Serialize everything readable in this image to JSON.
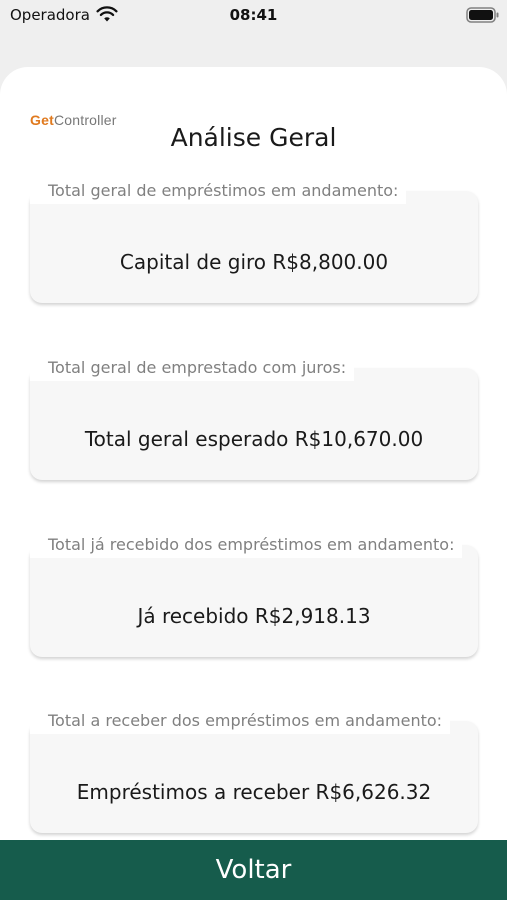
{
  "status_bar": {
    "carrier": "Operadora",
    "time": "08:41",
    "icons": [
      "wifi-icon",
      "battery-icon"
    ]
  },
  "brand": {
    "part1": "Get",
    "part2": "Controller",
    "accent_color": "#e07a1f"
  },
  "page": {
    "title": "Análise Geral"
  },
  "sections": [
    {
      "label": "Total geral de empréstimos em andamento:",
      "value": "Capital de giro R$8,800.00"
    },
    {
      "label": "Total geral de emprestado com juros:",
      "value": "Total geral esperado R$10,670.00"
    },
    {
      "label": "Total já recebido dos empréstimos em andamento:",
      "value": "Já recebido R$2,918.13"
    },
    {
      "label": "Total a receber dos empréstimos em andamento:",
      "value": "Empréstimos a receber R$6,626.32"
    }
  ],
  "footer": {
    "back_label": "Voltar",
    "button_color": "#165c4c"
  }
}
